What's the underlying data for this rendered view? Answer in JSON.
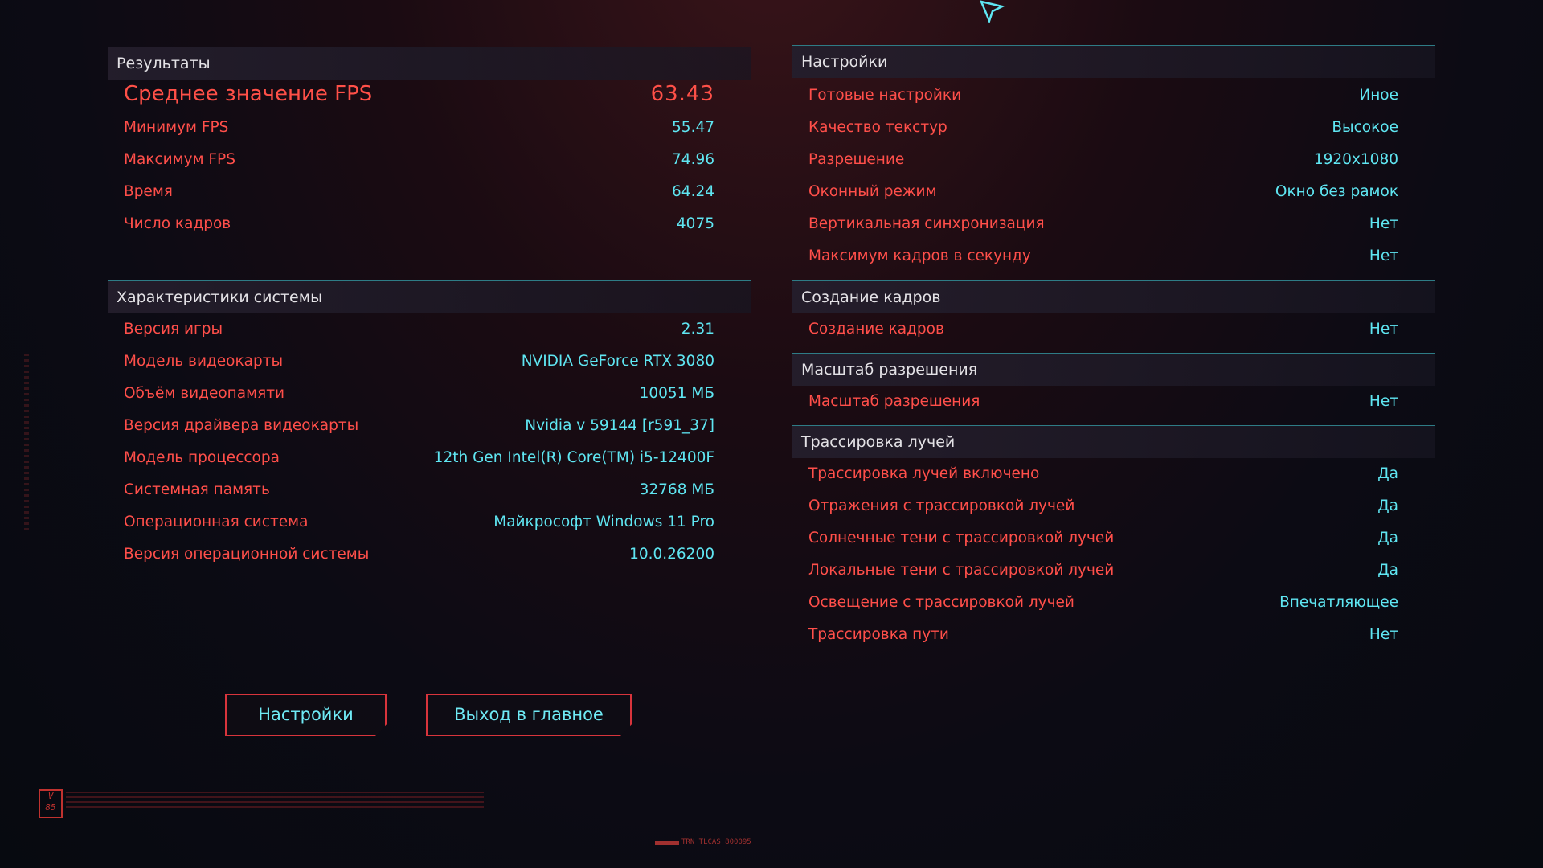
{
  "results": {
    "header": "Результаты",
    "rows": [
      {
        "label": "Среднее значение FPS",
        "value": "63.43"
      },
      {
        "label": "Минимум FPS",
        "value": "55.47"
      },
      {
        "label": "Максимум FPS",
        "value": "74.96"
      },
      {
        "label": "Время",
        "value": "64.24"
      },
      {
        "label": "Число кадров",
        "value": "4075"
      }
    ]
  },
  "system": {
    "header": "Характеристики системы",
    "rows": [
      {
        "label": "Версия игры",
        "value": "2.31"
      },
      {
        "label": "Модель видеокарты",
        "value": "NVIDIA GeForce RTX 3080"
      },
      {
        "label": "Объём видеопамяти",
        "value": "10051 МБ"
      },
      {
        "label": "Версия драйвера видеокарты",
        "value": "Nvidia v 59144 [r591_37]"
      },
      {
        "label": "Модель процессора",
        "value": "12th Gen Intel(R) Core(TM) i5-12400F"
      },
      {
        "label": "Системная память",
        "value": "32768 МБ"
      },
      {
        "label": "Операционная система",
        "value": "Майкрософт Windows 11 Pro"
      },
      {
        "label": "Версия операционной системы",
        "value": "10.0.26200"
      }
    ]
  },
  "settings": {
    "header": "Настройки",
    "rows": [
      {
        "label": "Готовые настройки",
        "value": "Иное"
      },
      {
        "label": "Качество текстур",
        "value": "Высокое"
      },
      {
        "label": "Разрешение",
        "value": "1920x1080"
      },
      {
        "label": "Оконный режим",
        "value": "Окно без рамок"
      },
      {
        "label": "Вертикальная синхронизация",
        "value": "Нет"
      },
      {
        "label": "Максимум кадров в секунду",
        "value": "Нет"
      }
    ]
  },
  "frame_gen": {
    "header": "Создание кадров",
    "rows": [
      {
        "label": "Создание кадров",
        "value": "Нет"
      }
    ]
  },
  "res_scale": {
    "header": "Масштаб разрешения",
    "rows": [
      {
        "label": "Масштаб разрешения",
        "value": "Нет"
      }
    ]
  },
  "ray_tracing": {
    "header": "Трассировка лучей",
    "rows": [
      {
        "label": "Трассировка лучей включено",
        "value": "Да"
      },
      {
        "label": "Отражения с трассировкой лучей",
        "value": "Да"
      },
      {
        "label": "Солнечные тени с трассировкой лучей",
        "value": "Да"
      },
      {
        "label": "Локальные тени с трассировкой лучей",
        "value": "Да"
      },
      {
        "label": "Освещение с трассировкой лучей",
        "value": "Впечатляющее"
      },
      {
        "label": "Трассировка пути",
        "value": "Нет"
      }
    ]
  },
  "buttons": {
    "settings": "Настройки",
    "exit": "Выход в главное меню"
  },
  "logo": {
    "line1": "V",
    "line2": "85"
  },
  "bottom_tag": "TRN_TLCAS_800095",
  "colors": {
    "label": "#ff4f4a",
    "value": "#5fe6f2",
    "divider": "#2e7c86",
    "button_border": "#d8343c"
  },
  "icons": {
    "cursor": "mouse-pointer-icon",
    "logo": "v85-logo-icon"
  }
}
